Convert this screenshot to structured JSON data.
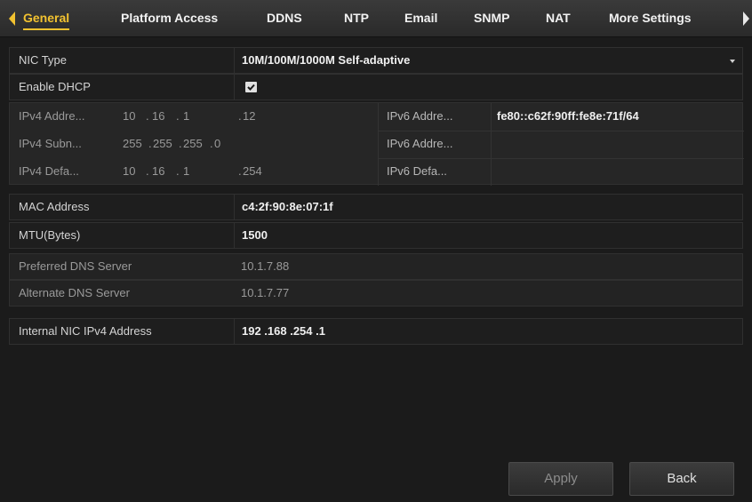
{
  "tabs": [
    {
      "label": "General",
      "active": true
    },
    {
      "label": "Platform Access"
    },
    {
      "label": "DDNS"
    },
    {
      "label": "NTP"
    },
    {
      "label": "Email"
    },
    {
      "label": "SNMP"
    },
    {
      "label": "NAT"
    },
    {
      "label": "More Settings"
    }
  ],
  "nic_type": {
    "label": "NIC Type",
    "value": "10M/100M/1000M Self-adaptive"
  },
  "dhcp": {
    "label": "Enable DHCP",
    "checked": true
  },
  "ipv4": {
    "address_label": "IPv4 Addre...",
    "address": [
      "10",
      "16",
      "1",
      "12"
    ],
    "subnet_label": "IPv4 Subn...",
    "subnet": [
      "255",
      "255",
      "255",
      "0"
    ],
    "gateway_label": "IPv4 Defa...",
    "gateway": [
      "10",
      "16",
      "1",
      "254"
    ]
  },
  "ipv6": {
    "address1_label": "IPv6 Addre...",
    "address1": "fe80::c62f:90ff:fe8e:71f/64",
    "address2_label": "IPv6 Addre...",
    "address2": "",
    "gateway_label": "IPv6 Defa...",
    "gateway": ""
  },
  "mac": {
    "label": "MAC Address",
    "value": "c4:2f:90:8e:07:1f"
  },
  "mtu": {
    "label": "MTU(Bytes)",
    "value": "1500"
  },
  "dns": {
    "preferred_label": "Preferred DNS Server",
    "preferred": "10.1.7.88",
    "alternate_label": "Alternate DNS Server",
    "alternate": "10.1.7.77"
  },
  "internal_nic": {
    "label": "Internal NIC IPv4 Address",
    "value": "192 .168 .254 .1"
  },
  "buttons": {
    "apply": "Apply",
    "back": "Back"
  },
  "colors": {
    "accent": "#f2c230",
    "background": "#161616"
  }
}
